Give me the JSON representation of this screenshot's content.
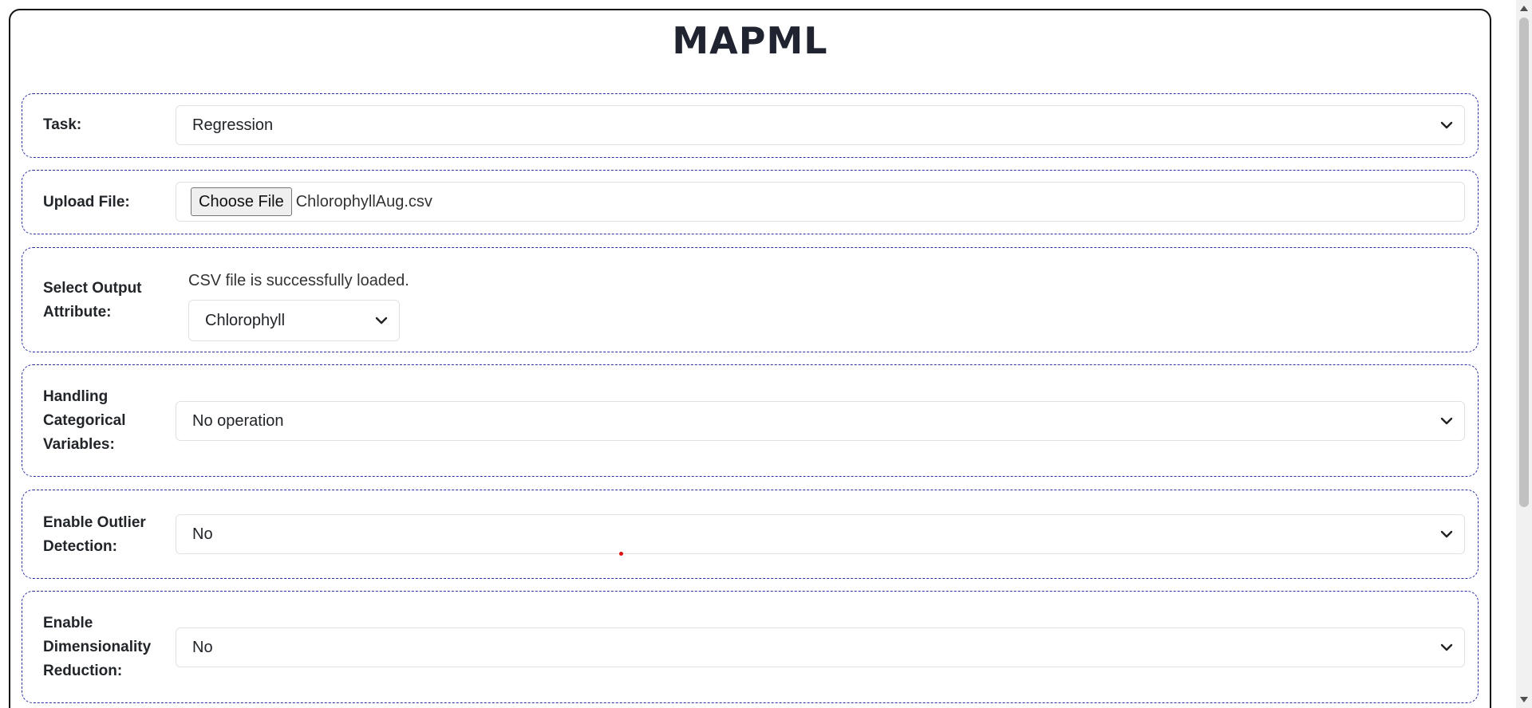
{
  "app": {
    "title": "MAPML"
  },
  "task": {
    "label": "Task:",
    "value": "Regression"
  },
  "upload": {
    "label": "Upload File:",
    "button_label": "Choose File",
    "file_name": "ChlorophyllAug.csv"
  },
  "output_attribute": {
    "label_line1": "Select Output",
    "label_line2": "Attribute:",
    "status": "CSV file is successfully loaded.",
    "value": "Chlorophyll"
  },
  "categorical": {
    "label_line1": "Handling",
    "label_line2": "Categorical",
    "label_line3": "Variables:",
    "value": "No operation"
  },
  "outlier": {
    "label_line1": "Enable Outlier",
    "label_line2": "Detection:",
    "value": "No"
  },
  "dimensionality": {
    "label_line1": "Enable",
    "label_line2": "Dimensionality",
    "label_line3": "Reduction:",
    "value": "No"
  },
  "icons": {
    "dropdown": "chevron-down-icon"
  },
  "colors": {
    "section_border": "#2a2f9e",
    "title": "#1f2430"
  }
}
